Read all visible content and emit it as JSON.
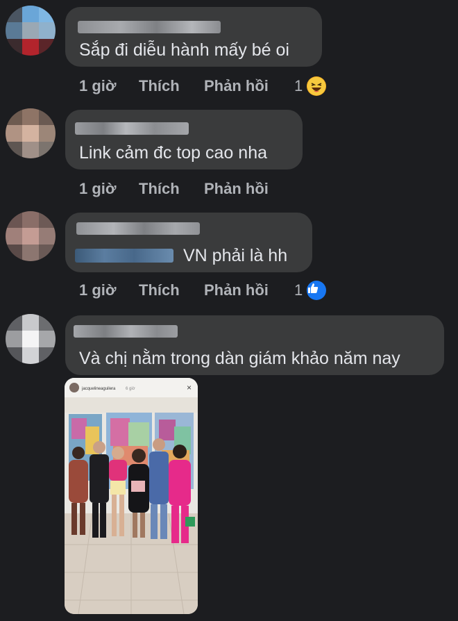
{
  "comments": [
    {
      "text": "Sắp đi diễu hành mấy bé oi",
      "time": "1 giờ",
      "like": "Thích",
      "reply": "Phản hồi",
      "reaction_count": "1",
      "reaction": "haha"
    },
    {
      "text": "Link cảm đc top cao nha",
      "time": "1 giờ",
      "like": "Thích",
      "reply": "Phản hồi"
    },
    {
      "text": "VN phải là hh",
      "time": "1 giờ",
      "like": "Thích",
      "reply": "Phản hồi",
      "reaction_count": "1",
      "reaction": "like"
    },
    {
      "text": "Và chị nằm trong dàn giám khảo năm nay"
    }
  ],
  "story": {
    "username": "jacquelineaguilera",
    "time": "6 giờ"
  },
  "colors": {
    "background": "#1c1d20",
    "bubble": "#3a3b3c",
    "text": "#e4e6eb",
    "meta": "#b0b3b8",
    "like_blue": "#1877f2",
    "haha_yellow": "#f7b125"
  }
}
